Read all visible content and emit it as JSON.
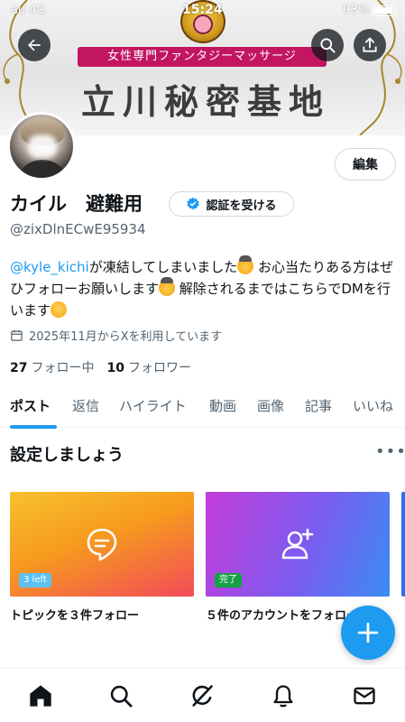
{
  "status": {
    "carrier": "au 4G",
    "time": "15:24",
    "battery": "93%"
  },
  "banner": {
    "strip_text": "女性専門ファンタジーマッサージ",
    "title": "立川秘密基地"
  },
  "profile": {
    "name": "カイル　避難用",
    "verify_label": "認証を受ける",
    "handle": "@zixDlnECwE95934",
    "edit_label": "編集",
    "bio": {
      "mention": "@kyle_kichi",
      "part1": "が凍結してしまいました",
      "part2": "お心当たりある方はぜひフォローお願いします",
      "part3": "解除されるまではこちらでDMを行います"
    },
    "joined": "2025年11月からXを利用しています",
    "following_count": "27",
    "following_label": "フォロー中",
    "followers_count": "10",
    "followers_label": "フォロワー"
  },
  "tabs": [
    "ポスト",
    "返信",
    "ハイライト",
    "動画",
    "画像",
    "記事",
    "いいね"
  ],
  "setup": {
    "title": "設定しましょう",
    "more": "•••",
    "cards": [
      {
        "badge": "3 left",
        "label": "トピックを３件フォロー"
      },
      {
        "badge": "完了",
        "label": "５件のアカウントをフォロー"
      }
    ]
  },
  "colors": {
    "accent": "#1d9bf0",
    "banner_strip": "#c21562"
  },
  "icons": {
    "back": "back-arrow-icon",
    "search": "search-icon",
    "share": "share-icon",
    "fab": "compose-plus-icon",
    "nav": [
      "home-icon",
      "search-icon",
      "grok-icon",
      "notifications-icon",
      "messages-icon"
    ]
  }
}
